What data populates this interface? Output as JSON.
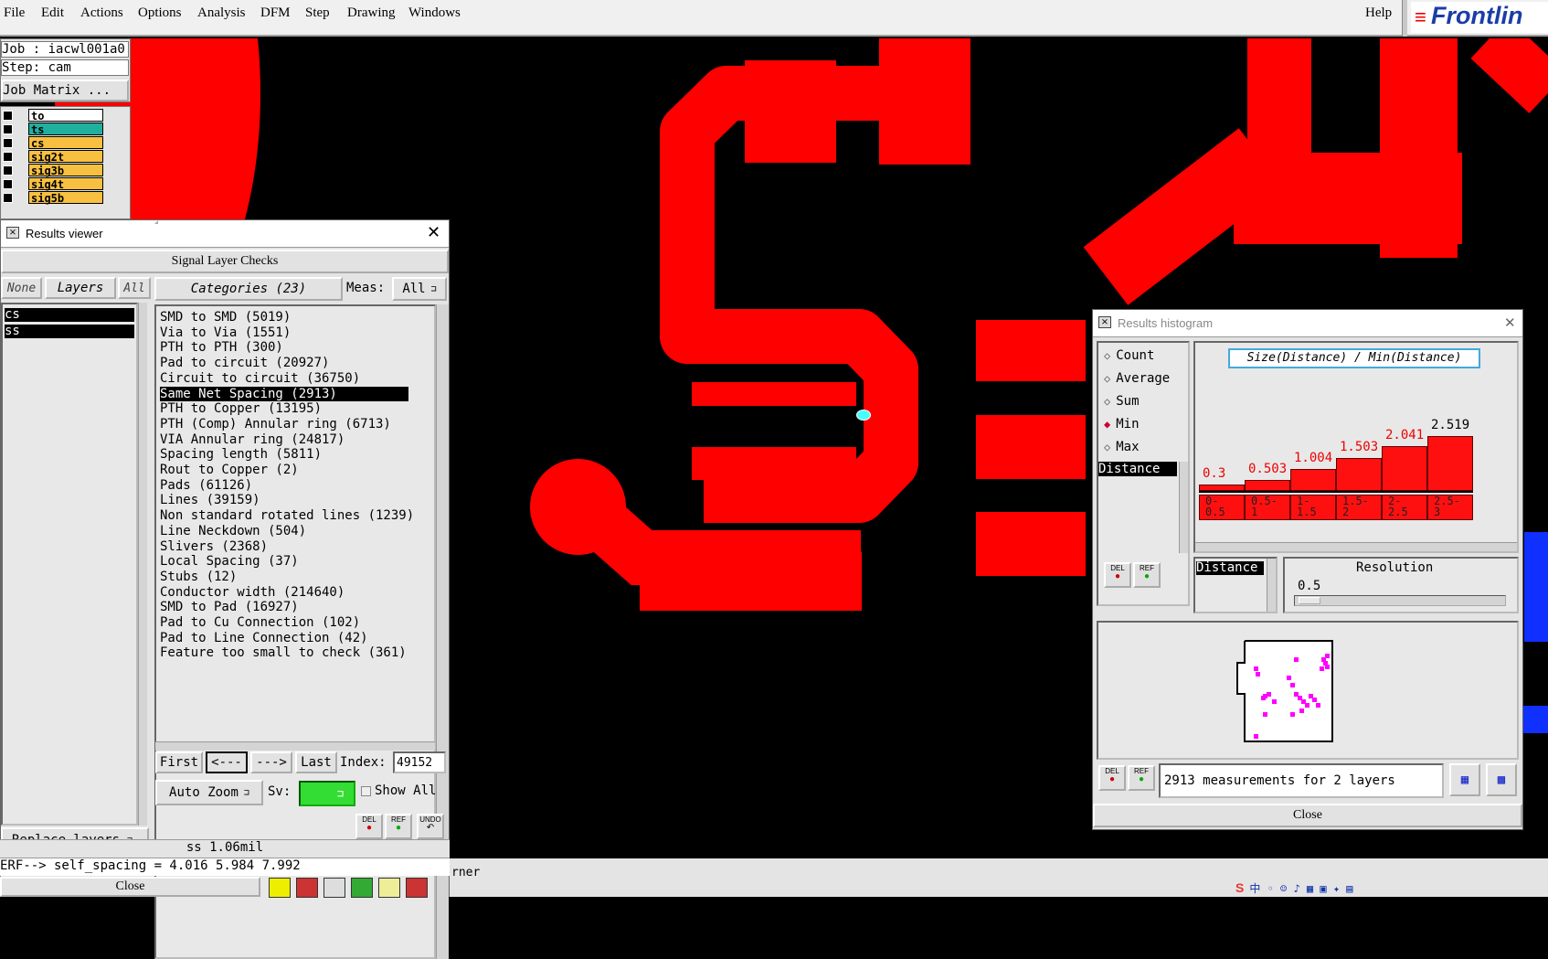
{
  "menubar": {
    "items": [
      "File",
      "Edit",
      "Actions",
      "Options",
      "Analysis",
      "DFM",
      "Step",
      "Drawing",
      "Windows"
    ],
    "help": "Help",
    "brand": "Frontlin"
  },
  "job": {
    "job_label": "Job : iacwl001a0",
    "step_label": "Step: cam",
    "matrix_button": "Job Matrix ..."
  },
  "layers": [
    {
      "name": "to",
      "color": "#ffffff"
    },
    {
      "name": "ts",
      "color": "#20b0a0"
    },
    {
      "name": "cs",
      "color": "#f8c040"
    },
    {
      "name": "sig2t",
      "color": "#f8c040"
    },
    {
      "name": "sig3b",
      "color": "#f8c040"
    },
    {
      "name": "sig4t",
      "color": "#f8c040"
    },
    {
      "name": "sig5b",
      "color": "#f8c040"
    }
  ],
  "results_viewer": {
    "title": "Results viewer",
    "header": "Signal Layer Checks",
    "btn_none": "None",
    "btn_layers": "Layers",
    "btn_all": "All",
    "categories_label": "Categories (23)",
    "meas_label": "Meas:",
    "meas_value": "All",
    "selected_layers": [
      "cs",
      "ss"
    ],
    "categories": [
      "SMD to SMD (5019)",
      "Via to Via (1551)",
      "PTH to PTH (300)",
      "Pad to circuit (20927)",
      "Circuit to circuit (36750)",
      "Same Net Spacing (2913)",
      "PTH to Copper (13195)",
      "PTH (Comp) Annular ring (6713)",
      "VIA Annular ring (24817)",
      "Spacing length (5811)",
      "Rout to Copper (2)",
      "Pads (61126)",
      "Lines (39159)",
      "Non standard rotated lines (1239)",
      "Line Neckdown (504)",
      "Slivers (2368)",
      "Local Spacing (37)",
      "Stubs (12)",
      "Conductor width (214640)",
      "SMD to Pad (16927)",
      "Pad to Cu Connection (102)",
      "Pad to Line Connection (42)",
      "Feature too small to check (361)"
    ],
    "selected_category_index": 5,
    "nav": {
      "first": "First",
      "prev": "<---",
      "next": "--->",
      "last": "Last",
      "index_label": "Index:",
      "index_value": "49152"
    },
    "auto_zoom": "Auto Zoom",
    "sv_label": "Sv:",
    "show_all": "Show All",
    "replace_layers": "Replace layers",
    "del": "DEL",
    "ref": "REF",
    "undo": "UNDO",
    "status1": "ss 1.06mil",
    "status2": "ERF--> self_spacing = 4.016 5.984 7.992",
    "close": "Close"
  },
  "histogram": {
    "title": "Results histogram",
    "options": [
      "Count",
      "Average",
      "Sum",
      "Min",
      "Max"
    ],
    "selected_option": "Min",
    "metric_title": "Size(Distance) / Min(Distance)",
    "measure_list": [
      "Distance"
    ],
    "bars": [
      {
        "value": "0.3",
        "label": "0-\n0.5",
        "v": 0.3
      },
      {
        "value": "0.503",
        "label": "0.5-\n1",
        "v": 0.503
      },
      {
        "value": "1.004",
        "label": "1-\n1.5",
        "v": 1.004
      },
      {
        "value": "1.503",
        "label": "1.5-\n2",
        "v": 1.503
      },
      {
        "value": "2.041",
        "label": "2-\n2.5",
        "v": 2.041
      },
      {
        "value": "2.519",
        "label": "2.5-\n3",
        "v": 2.519
      }
    ],
    "resolution_field": "Distance",
    "resolution_label": "Resolution",
    "resolution_value": "0.5",
    "summary": "2913 measurements for 2 layers",
    "close": "Close",
    "del": "DEL",
    "ref": "REF"
  },
  "canvas": {
    "bottom_text": "rner"
  },
  "colors": {
    "copper": "#ff0000",
    "background": "#000000",
    "selection": "#000000",
    "sv_green": "#33dd33"
  }
}
